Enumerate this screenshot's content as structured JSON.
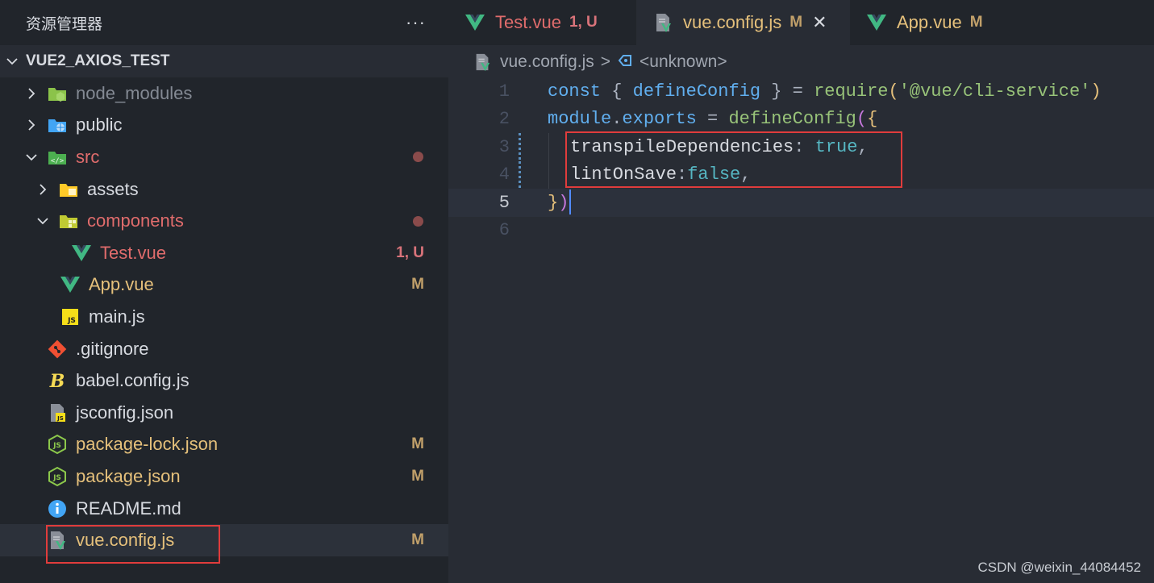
{
  "sidebar": {
    "title": "资源管理器",
    "more_label": "···",
    "project_name": "VUE2_AXIOS_TEST",
    "items": [
      {
        "label": "node_modules",
        "icon": "node-folder-icon",
        "badge": ""
      },
      {
        "label": "public",
        "icon": "public-folder-icon",
        "badge": ""
      },
      {
        "label": "src",
        "icon": "src-folder-icon",
        "badge": ""
      },
      {
        "label": "assets",
        "icon": "assets-folder-icon",
        "badge": ""
      },
      {
        "label": "components",
        "icon": "components-folder-icon",
        "badge": ""
      },
      {
        "label": "Test.vue",
        "icon": "vue-icon",
        "badge": "1, U"
      },
      {
        "label": "App.vue",
        "icon": "vue-icon",
        "badge": "M"
      },
      {
        "label": "main.js",
        "icon": "js-icon",
        "badge": ""
      },
      {
        "label": ".gitignore",
        "icon": "git-icon",
        "badge": ""
      },
      {
        "label": "babel.config.js",
        "icon": "babel-icon",
        "badge": ""
      },
      {
        "label": "jsconfig.json",
        "icon": "jsconfig-icon",
        "badge": ""
      },
      {
        "label": "package-lock.json",
        "icon": "nodejs-icon",
        "badge": "M"
      },
      {
        "label": "package.json",
        "icon": "nodejs-icon",
        "badge": "M"
      },
      {
        "label": "README.md",
        "icon": "info-icon",
        "badge": ""
      },
      {
        "label": "vue.config.js",
        "icon": "vue-config-icon",
        "badge": "M"
      }
    ]
  },
  "tabs": [
    {
      "label": "Test.vue",
      "badge": "1, U",
      "active": false
    },
    {
      "label": "vue.config.js",
      "badge": "M",
      "active": true,
      "close": "✕"
    },
    {
      "label": "App.vue",
      "badge": "M",
      "active": false
    }
  ],
  "breadcrumb": {
    "file": "vue.config.js",
    "separator": ">",
    "symbol": "<unknown>"
  },
  "editor": {
    "line_numbers": [
      "1",
      "2",
      "3",
      "4",
      "5",
      "6"
    ],
    "current_line": "5",
    "code": {
      "l1": {
        "a": "const",
        "b": " { ",
        "c": "defineConfig",
        "d": " } = ",
        "e": "require",
        "f": "(",
        "g": "'@vue/cli-service'",
        "h": ")"
      },
      "l2": {
        "a": "module",
        "b": ".",
        "c": "exports",
        "d": " = ",
        "e": "defineConfig",
        "f": "(",
        "g": "{"
      },
      "l3": {
        "a": "transpileDependencies",
        "b": ": ",
        "c": "true",
        "d": ","
      },
      "l4": {
        "a": "lintOnSave",
        "b": ":",
        "c": "false",
        "d": ","
      },
      "l5": {
        "a": "}",
        "b": ")"
      }
    }
  },
  "watermark": "CSDN @weixin_44084452",
  "colors": {
    "accent_highlight": "#e03c3c",
    "vue_green": "#41b883",
    "modified": "#c1a06a",
    "untracked": "#d9737a"
  }
}
